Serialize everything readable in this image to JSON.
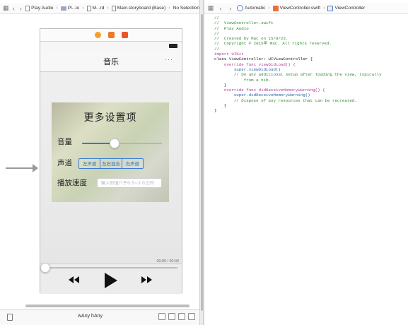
{
  "left_jumpbar": {
    "segments": [
      "Play Audio",
      "Pl...io",
      "M...rd",
      "Main.storyboard (Base)",
      "No Selection"
    ]
  },
  "right_jumpbar": {
    "mode": "Automatic",
    "file": "ViewController.swift",
    "symbol": "ViewController"
  },
  "scene": {
    "nav_title": "音乐",
    "nav_more": "···",
    "panel_title": "更多设置项",
    "volume_label": "音量",
    "volume_value": 0.41,
    "channel_label": "声道",
    "channel_segments": [
      "左声道",
      "左右混合",
      "右声道"
    ],
    "speed_label": "播放速度",
    "speed_placeholder": "输入的值介于0.5~2.0之间",
    "time_text": "00:00 / 00:00",
    "progress_value": 0
  },
  "canvas_bottom": {
    "size_class": "wAny hAny"
  },
  "code_lines": [
    {
      "cls": "c-comment",
      "text": "//"
    },
    {
      "cls": "c-comment",
      "text": "//  ViewController.swift"
    },
    {
      "cls": "c-comment",
      "text": "//  Play Audio"
    },
    {
      "cls": "c-comment",
      "text": "//"
    },
    {
      "cls": "c-comment",
      "text": "//  Created by Mac on 15/8/23."
    },
    {
      "cls": "c-comment",
      "text": "//  Copyright © 2015年 Mac. All rights reserved."
    },
    {
      "cls": "c-comment",
      "text": "//"
    },
    {
      "cls": "c-plain",
      "text": ""
    },
    {
      "cls": "c-kw",
      "text": "import UIKit"
    },
    {
      "cls": "c-plain",
      "text": ""
    },
    {
      "cls": "c-plain",
      "text": "class ViewController: UIViewController {"
    },
    {
      "cls": "c-plain",
      "text": ""
    },
    {
      "cls": "c-plain",
      "text": ""
    },
    {
      "cls": "c-plain",
      "text": ""
    },
    {
      "cls": "c-kw",
      "text": "    override func viewDidLoad() {"
    },
    {
      "cls": "c-fn",
      "text": "        super.viewDidLoad()"
    },
    {
      "cls": "c-comment",
      "text": "        // Do any additional setup after loading the view, typically"
    },
    {
      "cls": "c-comment",
      "text": "            from a nib."
    },
    {
      "cls": "c-plain",
      "text": "    }"
    },
    {
      "cls": "c-plain",
      "text": ""
    },
    {
      "cls": "c-plain",
      "text": ""
    },
    {
      "cls": "c-plain",
      "text": ""
    },
    {
      "cls": "c-kw",
      "text": "    override func didReceiveMemoryWarning() {"
    },
    {
      "cls": "c-fn",
      "text": "        super.didReceiveMemoryWarning()"
    },
    {
      "cls": "c-comment",
      "text": "        // Dispose of any resources that can be recreated."
    },
    {
      "cls": "c-plain",
      "text": "    }"
    },
    {
      "cls": "c-plain",
      "text": ""
    },
    {
      "cls": "c-plain",
      "text": ""
    },
    {
      "cls": "c-plain",
      "text": "}"
    }
  ],
  "icons": {
    "back": "chevron-left-icon",
    "forward": "chevron-right-icon",
    "grid": "related-items-icon",
    "rewind": "rewind-icon",
    "play": "play-icon",
    "fast_forward": "fast-forward-icon"
  },
  "colors": {
    "accent": "#2a7ae2",
    "comment": "#2d8a2d",
    "keyword": "#b23a9a"
  }
}
